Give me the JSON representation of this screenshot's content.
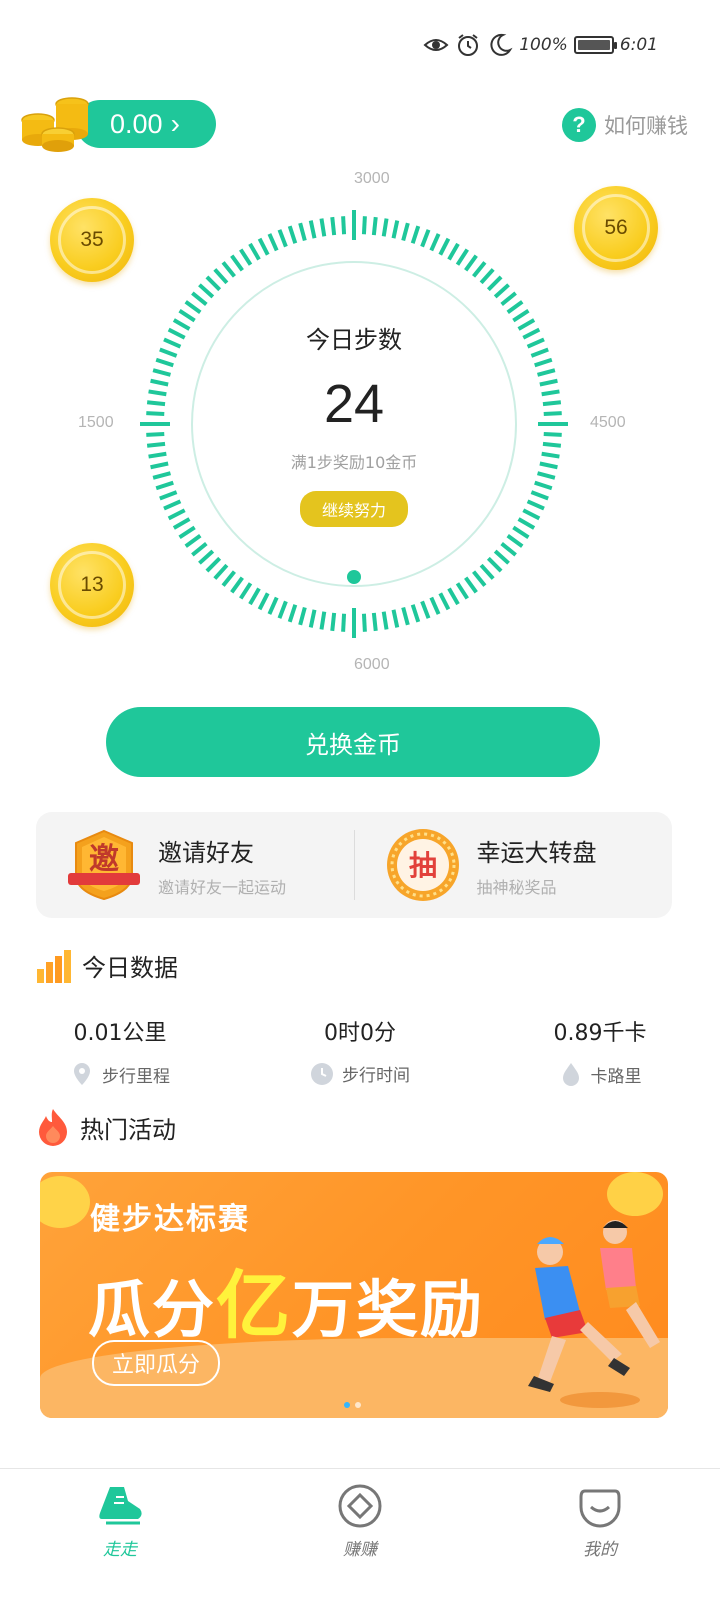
{
  "status_bar": {
    "battery": "100%",
    "time": "6:01",
    "battery_level": 1.0
  },
  "header": {
    "balance": "0.00",
    "how_to_earn": "如何赚钱"
  },
  "floating_coins": [
    "35",
    "56",
    "13"
  ],
  "dial": {
    "top_label": "3000",
    "left_label": "1500",
    "right_label": "4500",
    "bottom_label": "6000",
    "title": "今日步数",
    "steps": "24",
    "reward_text": "满1步奖励10金币",
    "badge": "继续努力"
  },
  "exchange_button": "兑换金币",
  "promo": {
    "invite": {
      "icon_char": "邀",
      "title": "邀请好友",
      "subtitle": "邀请好友一起运动"
    },
    "lottery": {
      "icon_char": "抽",
      "title": "幸运大转盘",
      "subtitle": "抽神秘奖品"
    }
  },
  "today_data": {
    "title": "今日数据",
    "stats": [
      {
        "value": "0.01公里",
        "label": "步行里程",
        "icon": "location-pin-icon"
      },
      {
        "value": "0时0分",
        "label": "步行时间",
        "icon": "clock-icon"
      },
      {
        "value": "0.89千卡",
        "label": "卡路里",
        "icon": "flame-drop-icon"
      }
    ]
  },
  "hot_activity": {
    "title": "热门活动",
    "banner": {
      "subtitle": "健步达标赛",
      "main_pre": "瓜分",
      "main_highlight": "亿",
      "main_post": "万奖励",
      "button": "立即瓜分"
    }
  },
  "tabbar": [
    {
      "label": "走走",
      "active": true
    },
    {
      "label": "赚赚",
      "active": false
    },
    {
      "label": "我的",
      "active": false
    }
  ],
  "colors": {
    "accent": "#1fc79a",
    "coin": "#f9cd1f",
    "badge": "#e4c41e",
    "banner": "#ff9527"
  }
}
